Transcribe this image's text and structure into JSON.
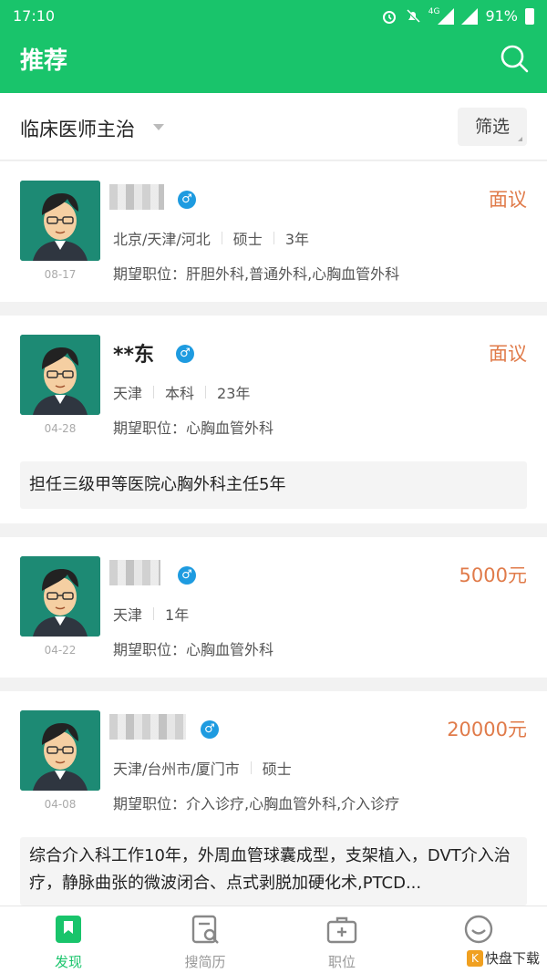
{
  "status_bar": {
    "time": "17:10",
    "network": "4G",
    "battery": "91%"
  },
  "header": {
    "title": "推荐",
    "search_icon": "search-icon"
  },
  "filter": {
    "category": "临床医师主治",
    "filter_label": "筛选"
  },
  "candidates": [
    {
      "name": "",
      "date": "08-17",
      "salary": "面议",
      "meta": [
        "北京/天津/河北",
        "硕士",
        "3年"
      ],
      "expect": "期望职位：肝胆外科,普通外科,心胸血管外科",
      "desc": ""
    },
    {
      "name": "**东",
      "date": "04-28",
      "salary": "面议",
      "meta": [
        "天津",
        "本科",
        "23年"
      ],
      "expect": "期望职位：心胸血管外科",
      "desc": "担任三级甲等医院心胸外科主任5年"
    },
    {
      "name": "",
      "date": "04-22",
      "salary": "5000元",
      "meta": [
        "天津",
        "1年"
      ],
      "expect": "期望职位：心胸血管外科",
      "desc": ""
    },
    {
      "name": "",
      "date": "04-08",
      "salary": "20000元",
      "meta": [
        "天津/台州市/厦门市",
        "硕士"
      ],
      "expect": "期望职位：介入诊疗,心胸血管外科,介入诊疗",
      "desc": "综合介入科工作10年，外周血管球囊成型，支架植入，DVT介入治疗，静脉曲张的微波闭合、点式剥脱加硬化术,PTCD..."
    }
  ],
  "tabs": [
    {
      "label": "发现",
      "icon": "bookmark-icon",
      "active": true
    },
    {
      "label": "搜简历",
      "icon": "resume-search-icon",
      "active": false
    },
    {
      "label": "职位",
      "icon": "briefcase-icon",
      "active": false
    },
    {
      "label": "",
      "icon": "smiley-icon",
      "active": false
    }
  ],
  "watermark": {
    "text": "快盘下载"
  },
  "colors": {
    "brand": "#19c46b",
    "salary": "#e07b4a",
    "gender": "#1e9be0"
  }
}
